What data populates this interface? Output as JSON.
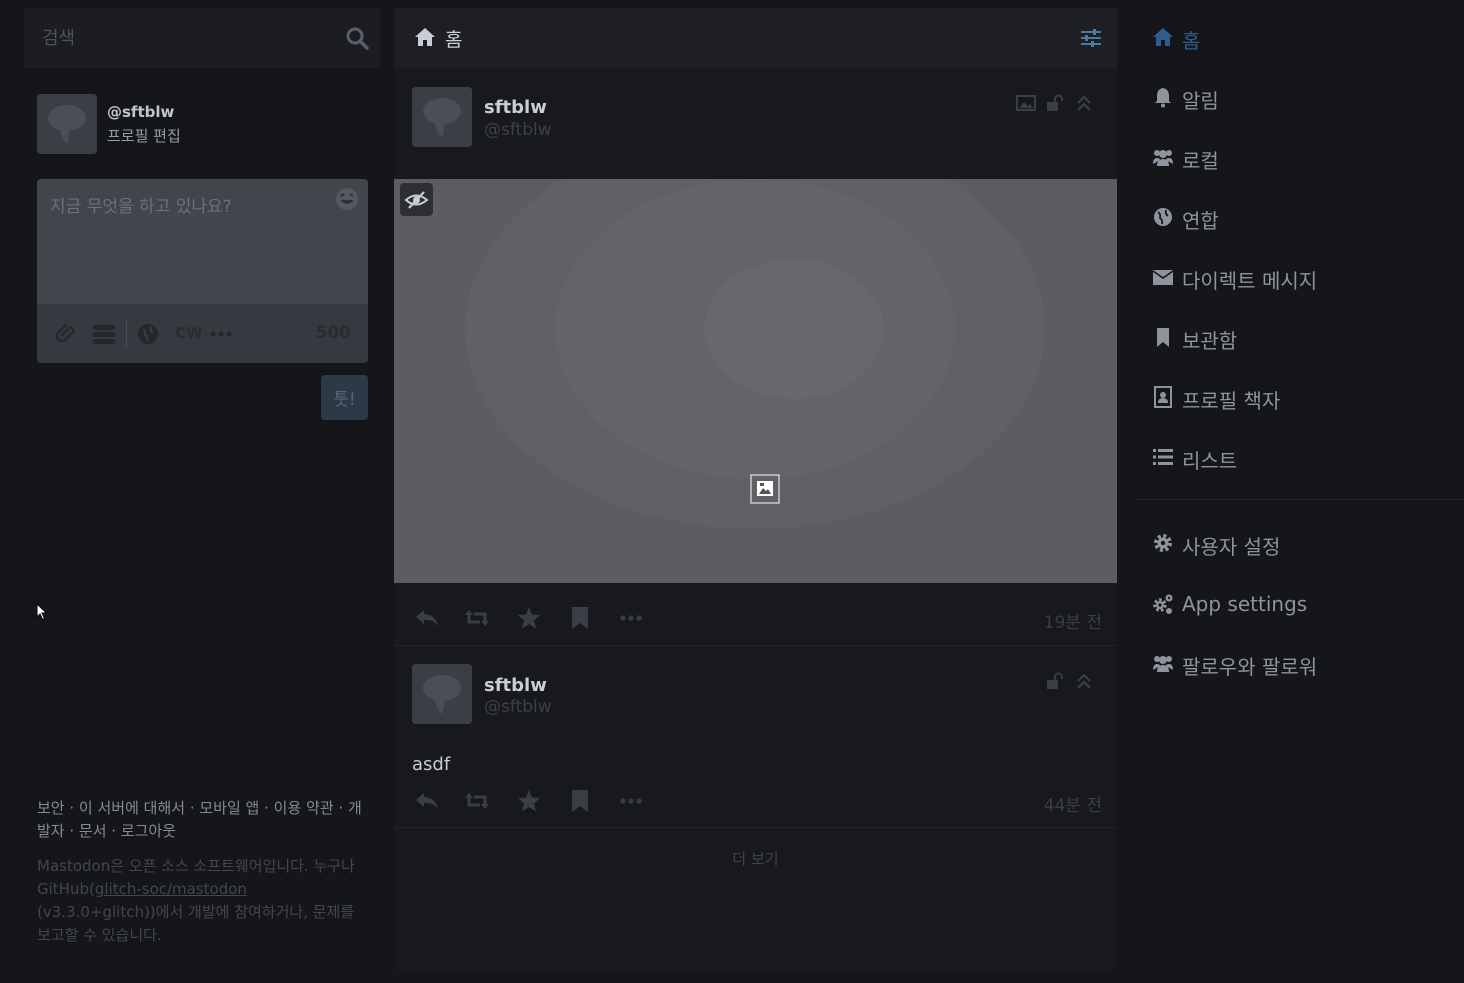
{
  "search": {
    "placeholder": "검색"
  },
  "me": {
    "handle": "@sftblw",
    "edit_profile": "프로필 편집"
  },
  "compose": {
    "placeholder": "지금 무엇을 하고 있나요?",
    "cw_label": "CW",
    "char_count": "500",
    "toot_label": "툿!"
  },
  "footer": {
    "links": [
      "보안",
      "이 서버에 대해서",
      "모바일 앱",
      "이용 약관",
      "개발자",
      "문서",
      "로그아웃"
    ],
    "separator": " · ",
    "about_1": "Mastodon은 오픈 소스 소프트웨어입니다. 누구나 GitHub(",
    "about_repo": "glitch-soc/mastodon",
    "about_2": " (v3.3.0+glitch))에서 개발에 참여하거나, 문제를 보고할 수 있습니다."
  },
  "column": {
    "title": "홈",
    "load_more": "더 보기"
  },
  "statuses": [
    {
      "display_name": "sftblw",
      "handle": "@sftblw",
      "text": "",
      "time": "19분 전",
      "has_media": true
    },
    {
      "display_name": "sftblw",
      "handle": "@sftblw",
      "text": "asdf",
      "time": "44분 전",
      "has_media": false
    }
  ],
  "nav": {
    "items": [
      {
        "label": "홈",
        "icon": "home-icon",
        "active": true
      },
      {
        "label": "알림",
        "icon": "bell-icon"
      },
      {
        "label": "로컬",
        "icon": "users-icon"
      },
      {
        "label": "연합",
        "icon": "globe-icon"
      },
      {
        "label": "다이렉트 메시지",
        "icon": "envelope-icon"
      },
      {
        "label": "보관함",
        "icon": "bookmark-icon"
      },
      {
        "label": "프로필 책자",
        "icon": "address-book-icon"
      },
      {
        "label": "리스트",
        "icon": "list-icon"
      }
    ],
    "settings": [
      {
        "label": "사용자 설정",
        "icon": "cog-icon"
      },
      {
        "label": "App settings",
        "icon": "cogs-icon"
      },
      {
        "label": "팔로우와 팔로워",
        "icon": "users-icon"
      }
    ]
  },
  "colors": {
    "background": "#151619",
    "accent": "#2f5d8f",
    "column": "#18191d"
  }
}
